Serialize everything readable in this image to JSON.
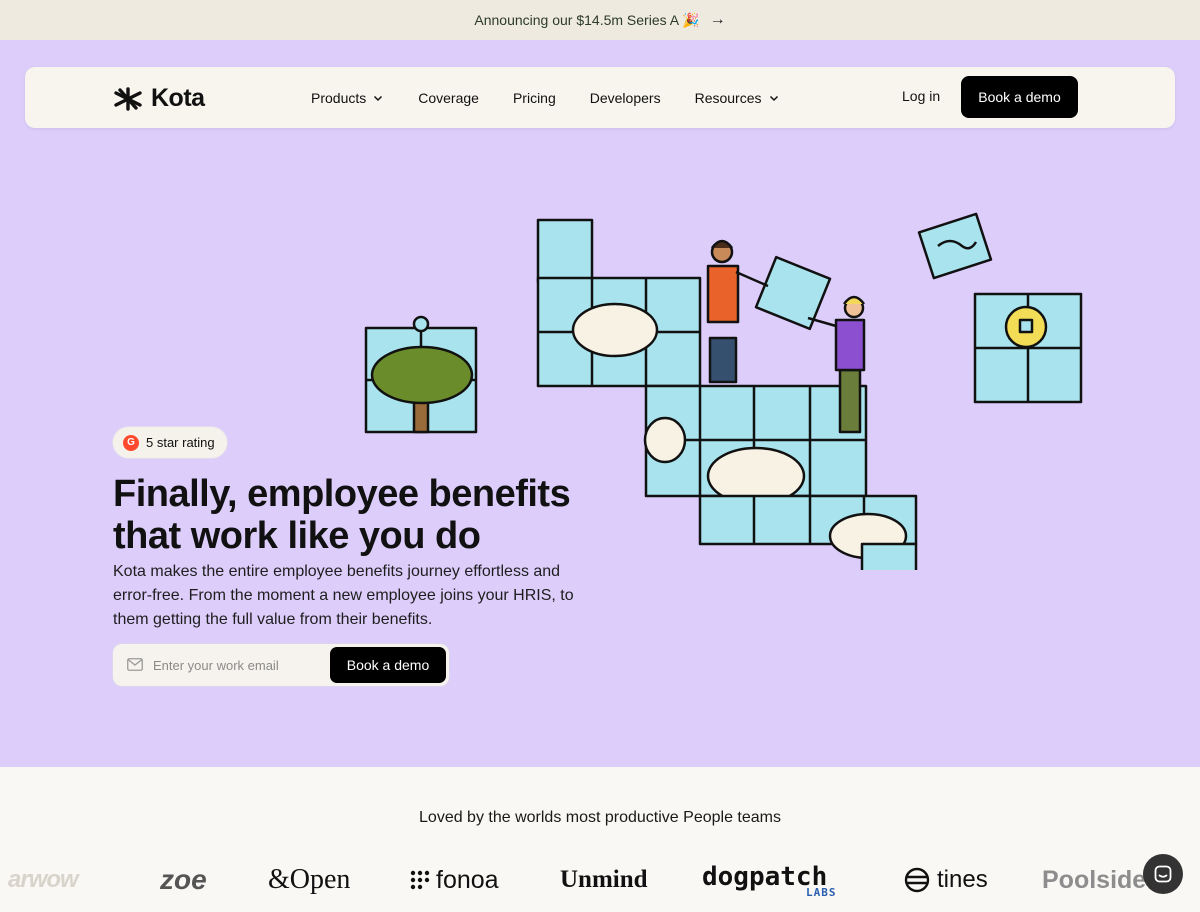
{
  "announcement": {
    "text": "Announcing our $14.5m Series A 🎉",
    "arrow_icon": "arrow-right-icon"
  },
  "nav": {
    "logo_text": "Kota",
    "links": [
      {
        "label": "Products",
        "has_dropdown": true
      },
      {
        "label": "Coverage",
        "has_dropdown": false
      },
      {
        "label": "Pricing",
        "has_dropdown": false
      },
      {
        "label": "Developers",
        "has_dropdown": false
      },
      {
        "label": "Resources",
        "has_dropdown": true
      }
    ],
    "login_label": "Log in",
    "demo_label": "Book a demo"
  },
  "hero": {
    "rating_badge": "5 star rating",
    "badge_logo_text": "G",
    "headline_line1": "Finally, employee benefits",
    "headline_line2": "that work like you do",
    "subtext": "Kota makes the entire employee benefits journey effortless and error-free. From the moment a new employee joins your HRIS, to them getting the full value from their benefits.",
    "email_placeholder": "Enter your work email",
    "cta_label": "Book a demo"
  },
  "customers": {
    "title": "Loved by the worlds most productive People teams",
    "logos": [
      "arwow",
      "zoe",
      "&Open",
      "fonoa",
      "Unmind",
      "dogpatch",
      "LABS",
      "tines",
      "Poolside"
    ]
  },
  "colors": {
    "hero_bg": "#dccdfb",
    "announce_bg": "#eeeae0",
    "puzzle": "#a9e4ee",
    "button": "#000000"
  }
}
